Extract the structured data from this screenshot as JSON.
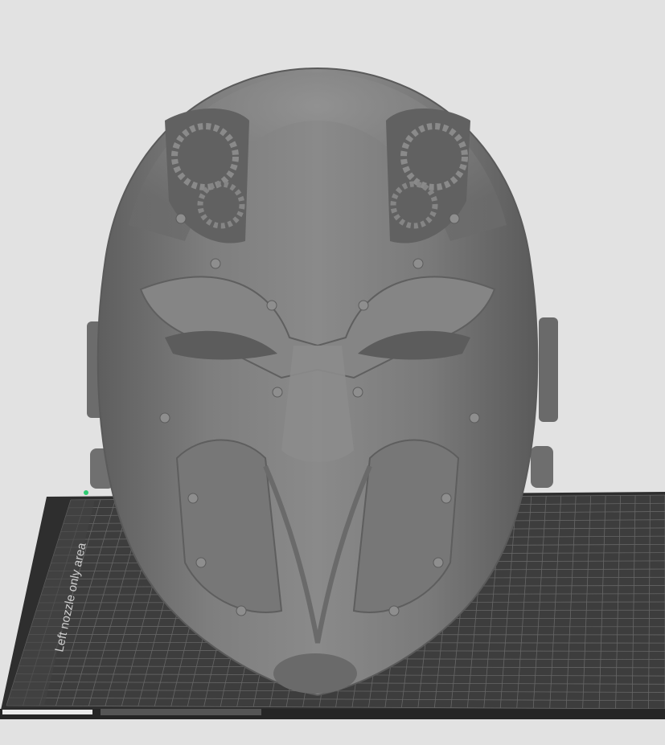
{
  "viewport": {
    "background": "#e2e2e2",
    "model_name": "steampunk-mask-model",
    "model_color": "#7d7d7d"
  },
  "build_plate": {
    "color": "#3b3b3b",
    "grid_color": "#6a6a6a",
    "zone_label": "Left nozzle only area",
    "origin_marker_color": "#2ecc71"
  }
}
